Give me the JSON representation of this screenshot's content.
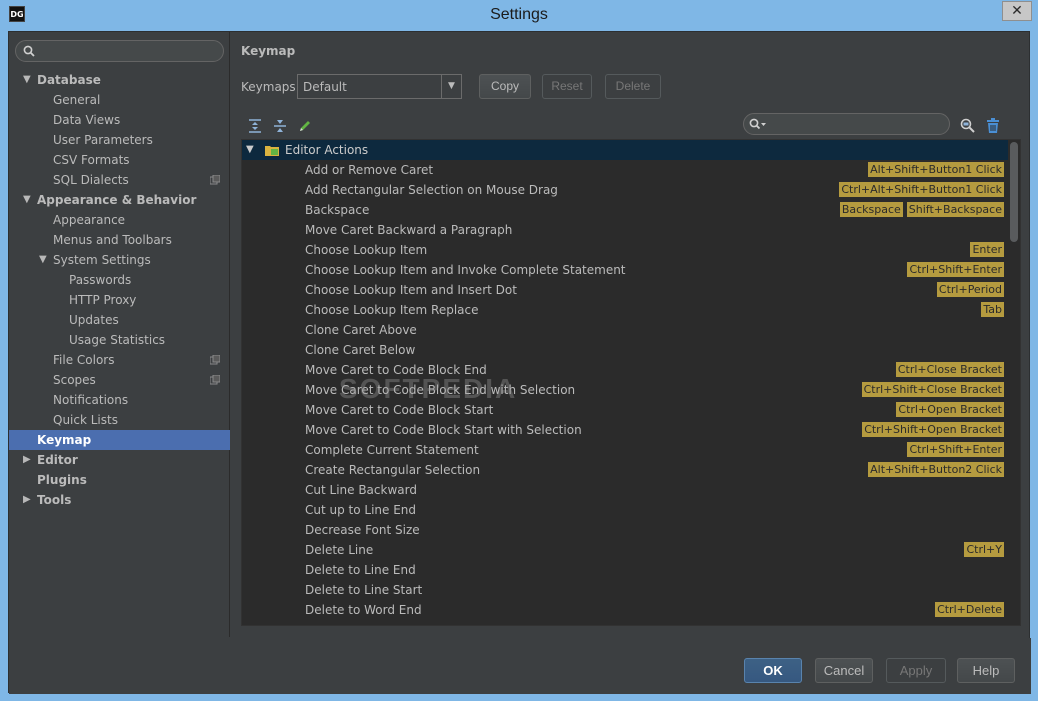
{
  "window": {
    "title": "Settings",
    "app_logo": "DG",
    "close_glyph": "✕"
  },
  "sidebar": {
    "search_placeholder": "",
    "items": [
      {
        "label": "Database",
        "level": 0,
        "bold": true,
        "arrow": "▼",
        "selected": false,
        "badge": false
      },
      {
        "label": "General",
        "level": 1,
        "bold": false,
        "arrow": "",
        "selected": false,
        "badge": false
      },
      {
        "label": "Data Views",
        "level": 1,
        "bold": false,
        "arrow": "",
        "selected": false,
        "badge": false
      },
      {
        "label": "User Parameters",
        "level": 1,
        "bold": false,
        "arrow": "",
        "selected": false,
        "badge": false
      },
      {
        "label": "CSV Formats",
        "level": 1,
        "bold": false,
        "arrow": "",
        "selected": false,
        "badge": false
      },
      {
        "label": "SQL Dialects",
        "level": 1,
        "bold": false,
        "arrow": "",
        "selected": false,
        "badge": true
      },
      {
        "label": "Appearance & Behavior",
        "level": 0,
        "bold": true,
        "arrow": "▼",
        "selected": false,
        "badge": false
      },
      {
        "label": "Appearance",
        "level": 1,
        "bold": false,
        "arrow": "",
        "selected": false,
        "badge": false
      },
      {
        "label": "Menus and Toolbars",
        "level": 1,
        "bold": false,
        "arrow": "",
        "selected": false,
        "badge": false
      },
      {
        "label": "System Settings",
        "level": 1,
        "bold": false,
        "arrow": "▼",
        "selected": false,
        "badge": false
      },
      {
        "label": "Passwords",
        "level": 2,
        "bold": false,
        "arrow": "",
        "selected": false,
        "badge": false
      },
      {
        "label": "HTTP Proxy",
        "level": 2,
        "bold": false,
        "arrow": "",
        "selected": false,
        "badge": false
      },
      {
        "label": "Updates",
        "level": 2,
        "bold": false,
        "arrow": "",
        "selected": false,
        "badge": false
      },
      {
        "label": "Usage Statistics",
        "level": 2,
        "bold": false,
        "arrow": "",
        "selected": false,
        "badge": false
      },
      {
        "label": "File Colors",
        "level": 1,
        "bold": false,
        "arrow": "",
        "selected": false,
        "badge": true
      },
      {
        "label": "Scopes",
        "level": 1,
        "bold": false,
        "arrow": "",
        "selected": false,
        "badge": true
      },
      {
        "label": "Notifications",
        "level": 1,
        "bold": false,
        "arrow": "",
        "selected": false,
        "badge": false
      },
      {
        "label": "Quick Lists",
        "level": 1,
        "bold": false,
        "arrow": "",
        "selected": false,
        "badge": false
      },
      {
        "label": "Keymap",
        "level": 0,
        "bold": true,
        "arrow": "",
        "selected": true,
        "badge": false
      },
      {
        "label": "Editor",
        "level": 0,
        "bold": true,
        "arrow": "▶",
        "selected": false,
        "badge": false
      },
      {
        "label": "Plugins",
        "level": 0,
        "bold": true,
        "arrow": "",
        "selected": false,
        "badge": false
      },
      {
        "label": "Tools",
        "level": 0,
        "bold": true,
        "arrow": "▶",
        "selected": false,
        "badge": false
      }
    ]
  },
  "main": {
    "title": "Keymap",
    "keymaps_label": "Keymaps:",
    "keymap_value": "Default",
    "copy_label": "Copy",
    "reset_label": "Reset",
    "delete_label": "Delete",
    "filter_placeholder": "",
    "group": {
      "label": "Editor Actions",
      "arrow": "▼"
    },
    "actions": [
      {
        "label": "Add or Remove Caret",
        "shortcuts": [
          "Alt+Shift+Button1 Click"
        ]
      },
      {
        "label": "Add Rectangular Selection on Mouse Drag",
        "shortcuts": [
          "Ctrl+Alt+Shift+Button1 Click"
        ]
      },
      {
        "label": "Backspace",
        "shortcuts": [
          "Backspace",
          "Shift+Backspace"
        ]
      },
      {
        "label": "Move Caret Backward a Paragraph",
        "shortcuts": []
      },
      {
        "label": "Choose Lookup Item",
        "shortcuts": [
          "Enter"
        ]
      },
      {
        "label": "Choose Lookup Item and Invoke Complete Statement",
        "shortcuts": [
          "Ctrl+Shift+Enter"
        ]
      },
      {
        "label": "Choose Lookup Item and Insert Dot",
        "shortcuts": [
          "Ctrl+Period"
        ]
      },
      {
        "label": "Choose Lookup Item Replace",
        "shortcuts": [
          "Tab"
        ]
      },
      {
        "label": "Clone Caret Above",
        "shortcuts": []
      },
      {
        "label": "Clone Caret Below",
        "shortcuts": []
      },
      {
        "label": "Move Caret to Code Block End",
        "shortcuts": [
          "Ctrl+Close Bracket"
        ]
      },
      {
        "label": "Move Caret to Code Block End with Selection",
        "shortcuts": [
          "Ctrl+Shift+Close Bracket"
        ]
      },
      {
        "label": "Move Caret to Code Block Start",
        "shortcuts": [
          "Ctrl+Open Bracket"
        ]
      },
      {
        "label": "Move Caret to Code Block Start with Selection",
        "shortcuts": [
          "Ctrl+Shift+Open Bracket"
        ]
      },
      {
        "label": "Complete Current Statement",
        "shortcuts": [
          "Ctrl+Shift+Enter"
        ]
      },
      {
        "label": "Create Rectangular Selection",
        "shortcuts": [
          "Alt+Shift+Button2 Click"
        ]
      },
      {
        "label": "Cut Line Backward",
        "shortcuts": []
      },
      {
        "label": "Cut up to Line End",
        "shortcuts": []
      },
      {
        "label": "Decrease Font Size",
        "shortcuts": []
      },
      {
        "label": "Delete Line",
        "shortcuts": [
          "Ctrl+Y"
        ]
      },
      {
        "label": "Delete to Line End",
        "shortcuts": []
      },
      {
        "label": "Delete to Line Start",
        "shortcuts": []
      },
      {
        "label": "Delete to Word End",
        "shortcuts": [
          "Ctrl+Delete"
        ]
      }
    ],
    "watermark": "SOFTPEDIA"
  },
  "footer": {
    "ok_label": "OK",
    "cancel_label": "Cancel",
    "apply_label": "Apply",
    "help_label": "Help"
  },
  "colors": {
    "accent_selected": "#4b6eaf",
    "shortcut_bg": "#b59b3f",
    "group_row_bg": "#0d293e",
    "panel_bg": "#3c3f41",
    "list_bg": "#2b2b2b"
  }
}
